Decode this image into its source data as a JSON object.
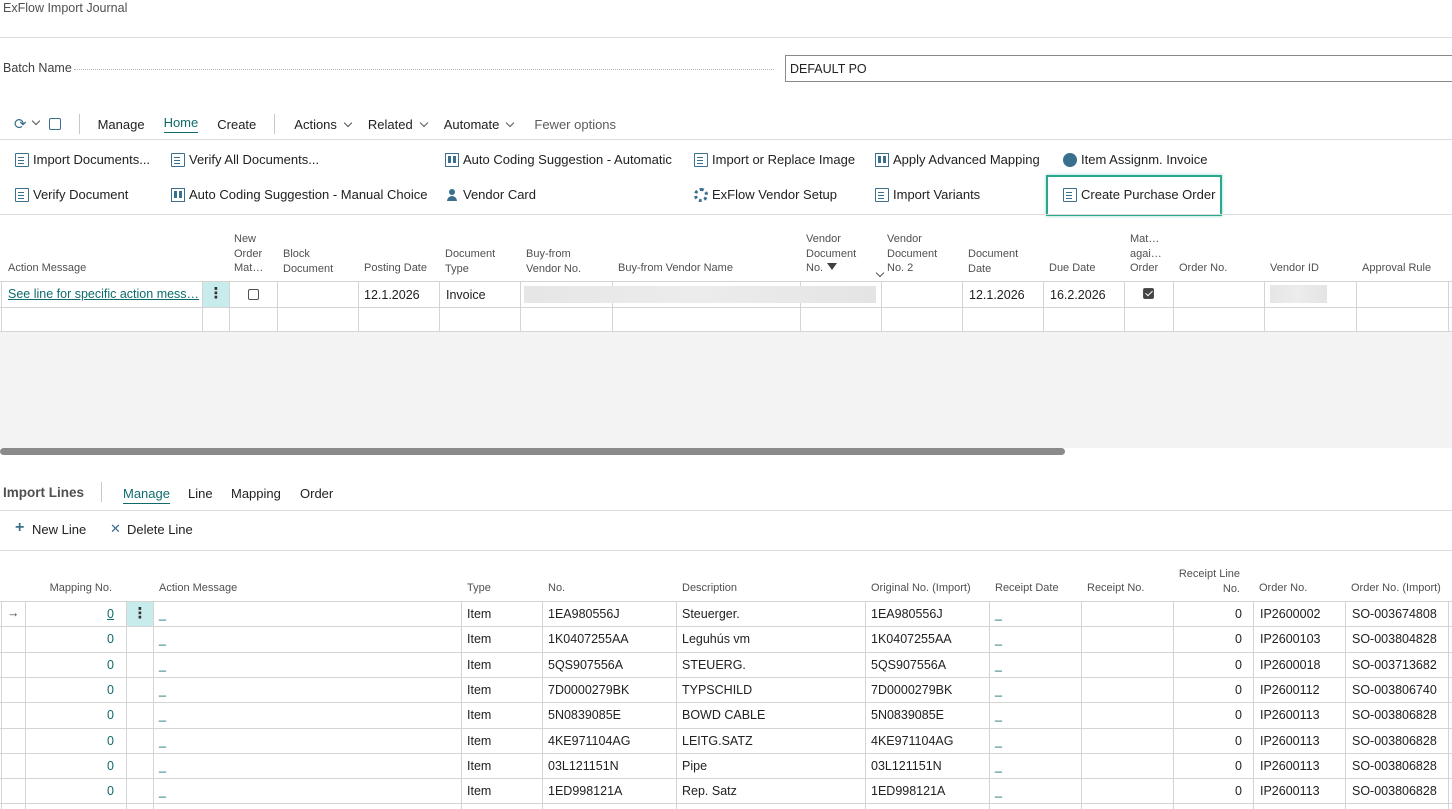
{
  "page": {
    "title": "ExFlow Import Journal"
  },
  "batch": {
    "label": "Batch Name",
    "value": "DEFAULT PO"
  },
  "nav": {
    "tabs": [
      "Manage",
      "Home",
      "Create"
    ],
    "menus": [
      "Actions",
      "Related",
      "Automate"
    ],
    "fewer": "Fewer options"
  },
  "actions": {
    "import_documents": "Import Documents...",
    "verify_all": "Verify All Documents...",
    "auto_coding_auto": "Auto Coding Suggestion - Automatic",
    "import_replace_image": "Import or Replace Image",
    "apply_advanced_mapping": "Apply Advanced Mapping",
    "item_assignm_invoice": "Item Assignm. Invoice",
    "verify_document": "Verify Document",
    "auto_coding_manual": "Auto Coding Suggestion - Manual Choice",
    "vendor_card": "Vendor Card",
    "vendor_setup": "ExFlow Vendor Setup",
    "import_variants": "Import Variants",
    "create_po": "Create Purchase Order"
  },
  "header_table": {
    "columns": {
      "action_message": "Action Message",
      "new_order": "New\nOrder\nMat…",
      "block_document": "Block\nDocument",
      "posting_date": "Posting Date",
      "document_type": "Document\nType",
      "buy_from_no": "Buy-from\nVendor No.",
      "buy_from_name": "Buy-from Vendor Name",
      "vendor_doc_no": "Vendor\nDocument\nNo.",
      "vendor_doc_no2": "Vendor\nDocument\nNo. 2",
      "document_date": "Document\nDate",
      "due_date": "Due Date",
      "match_order": "Mat…\nagai…\nOrder",
      "order_no": "Order No.",
      "vendor_id": "Vendor ID",
      "approval_rule": "Approval Rule"
    },
    "row": {
      "action_message": "See line for specific action mess…",
      "posting_date": "12.1.2026",
      "document_type": "Invoice",
      "document_date": "12.1.2026",
      "due_date": "16.2.2026",
      "new_order_checked": false,
      "match_order_checked": true
    }
  },
  "lines": {
    "title": "Import Lines",
    "tabs": [
      "Manage",
      "Line",
      "Mapping",
      "Order"
    ],
    "new_line": "New Line",
    "delete_line": "Delete Line",
    "columns": {
      "mapping_no": "Mapping No.",
      "action_message": "Action Message",
      "type": "Type",
      "no": "No.",
      "description": "Description",
      "original_no": "Original No. (Import)",
      "receipt_date": "Receipt Date",
      "receipt_no": "Receipt No.",
      "receipt_line_no": "Receipt Line\nNo.",
      "order_no": "Order No.",
      "order_no_import": "Order No. (Import)"
    },
    "rows": [
      {
        "mapping_no": "0",
        "action": "_",
        "type": "Item",
        "no": "1EA980556J",
        "description": "Steuerger.",
        "original_no": "1EA980556J",
        "receipt_date": "_",
        "receipt_line_no": "0",
        "order_no": "IP2600002",
        "order_no_import": "SO-003674808"
      },
      {
        "mapping_no": "0",
        "action": "_",
        "type": "Item",
        "no": "1K0407255AA",
        "description": "Leguhús vm",
        "original_no": "1K0407255AA",
        "receipt_date": "_",
        "receipt_line_no": "0",
        "order_no": "IP2600103",
        "order_no_import": "SO-003804828"
      },
      {
        "mapping_no": "0",
        "action": "_",
        "type": "Item",
        "no": "5QS907556A",
        "description": "STEUERG.",
        "original_no": "5QS907556A",
        "receipt_date": "_",
        "receipt_line_no": "0",
        "order_no": "IP2600018",
        "order_no_import": "SO-003713682"
      },
      {
        "mapping_no": "0",
        "action": "_",
        "type": "Item",
        "no": "7D0000279BK",
        "description": "TYPSCHILD",
        "original_no": "7D0000279BK",
        "receipt_date": "_",
        "receipt_line_no": "0",
        "order_no": "IP2600112",
        "order_no_import": "SO-003806740"
      },
      {
        "mapping_no": "0",
        "action": "_",
        "type": "Item",
        "no": "5N0839085E",
        "description": "BOWD CABLE",
        "original_no": "5N0839085E",
        "receipt_date": "_",
        "receipt_line_no": "0",
        "order_no": "IP2600113",
        "order_no_import": "SO-003806828"
      },
      {
        "mapping_no": "0",
        "action": "_",
        "type": "Item",
        "no": "4KE971104AG",
        "description": "LEITG.SATZ",
        "original_no": "4KE971104AG",
        "receipt_date": "_",
        "receipt_line_no": "0",
        "order_no": "IP2600113",
        "order_no_import": "SO-003806828"
      },
      {
        "mapping_no": "0",
        "action": "_",
        "type": "Item",
        "no": "03L121151N",
        "description": "Pipe",
        "original_no": "03L121151N",
        "receipt_date": "_",
        "receipt_line_no": "0",
        "order_no": "IP2600113",
        "order_no_import": "SO-003806828"
      },
      {
        "mapping_no": "0",
        "action": "_",
        "type": "Item",
        "no": "1ED998121A",
        "description": "Rep. Satz",
        "original_no": "1ED998121A",
        "receipt_date": "_",
        "receipt_line_no": "0",
        "order_no": "IP2600113",
        "order_no_import": "SO-003806828"
      }
    ]
  },
  "colors": {
    "accent": "#0f6b6b",
    "highlight": "#2aa88d",
    "kebab_bg": "#c8ecec"
  }
}
